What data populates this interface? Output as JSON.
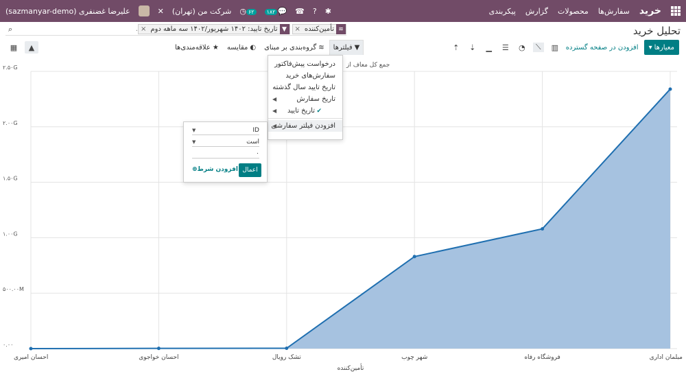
{
  "topbar": {
    "brand": "خرید",
    "menu": [
      "سفارش‌ها",
      "محصولات",
      "گزارش",
      "پیکربندی"
    ],
    "db_user": "(sazmanyar-demo) علیرضا غضنفری",
    "company": "شرکت من (تهران)",
    "activity_count": "۶۲",
    "message_count": "۱۸۲"
  },
  "page": {
    "title": "تحلیل خرید"
  },
  "search": {
    "placeholder": "...جستجو",
    "facets": [
      {
        "icon": "layers-icon",
        "text": "تأمین‌کننده"
      },
      {
        "icon": "filter-icon",
        "text": "تاریخ تایید: ۱۴۰۲ شهریور/۱۴۰۲ سه ماهه دوم"
      }
    ]
  },
  "toolbar": {
    "filters": "فیلترها",
    "group_by": "گروه‌بندی بر مبنای",
    "compare": "مقایسه",
    "favorites": "علاقه‌مندی‌ها",
    "measures": "معیارها",
    "expand": "افزودن در صفحه گسترده"
  },
  "filter_menu": {
    "items": [
      "درخواست پیش‌فاکتور",
      "سفارش‌های خرید",
      "تاریخ تایید سال گذشته",
      "تاریخ سفارش",
      "تاریخ تایید"
    ],
    "custom": "افزودن فیلتر سفارشی"
  },
  "custom_filter": {
    "field": "ID",
    "operator": "است",
    "value": "۰",
    "apply": "اعمال",
    "add_condition": "افزودن شرط"
  },
  "chart_data": {
    "type": "area",
    "categories": [
      "احسان امیری",
      "احسان خواجوی",
      "تشک رویال",
      "شهر چوب",
      "فروشگاه رفاه",
      "مبلمان اداری"
    ],
    "values": [
      0,
      2000000,
      3000000,
      830000000,
      1080000000,
      2340000000
    ],
    "series_label": "جمع کل معاف از",
    "xlabel": "تأمین‌کننده",
    "ylim": [
      0,
      2500000000
    ],
    "y_ticks": [
      "۰.۰۰",
      "۵۰۰.۰۰M",
      "۱.۰۰G",
      "۱.۵۰G",
      "۲.۰۰G",
      "۲.۵۰G"
    ],
    "fill_color": "#a6c2e0",
    "line_color": "#1f6fb0"
  }
}
